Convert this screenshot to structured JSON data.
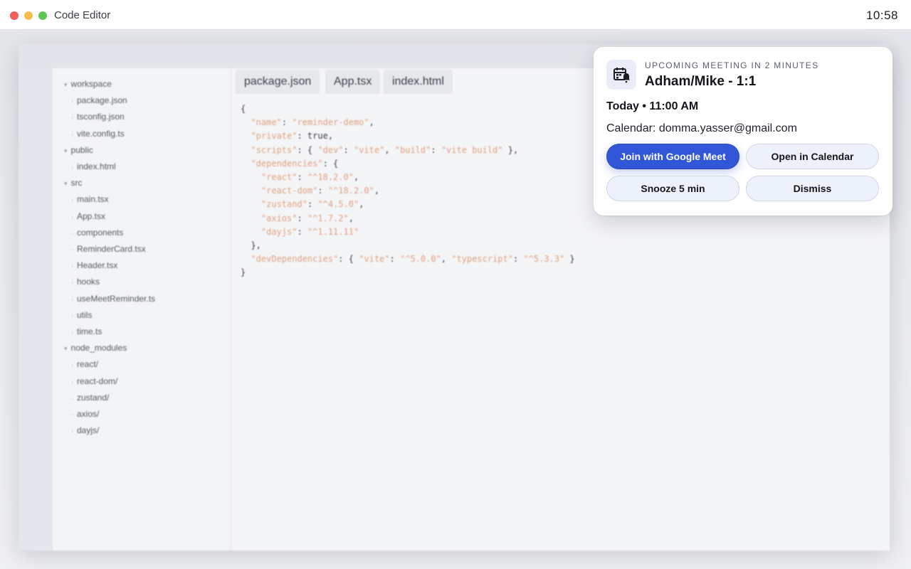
{
  "titlebar": {
    "app_title": "Code Editor",
    "clock": "10:58"
  },
  "explorer": {
    "items": [
      {
        "label": "workspace",
        "level": 0
      },
      {
        "label": "package.json",
        "level": 1
      },
      {
        "label": "tsconfig.json",
        "level": 1
      },
      {
        "label": "vite.config.ts",
        "level": 1
      },
      {
        "label": "public",
        "level": 0
      },
      {
        "label": "index.html",
        "level": 1
      },
      {
        "label": "src",
        "level": 0
      },
      {
        "label": "main.tsx",
        "level": 1
      },
      {
        "label": "App.tsx",
        "level": 1
      },
      {
        "label": "components",
        "level": 1
      },
      {
        "label": "ReminderCard.tsx",
        "level": 1
      },
      {
        "label": "Header.tsx",
        "level": 1
      },
      {
        "label": "hooks",
        "level": 1
      },
      {
        "label": "useMeetReminder.ts",
        "level": 1
      },
      {
        "label": "utils",
        "level": 1
      },
      {
        "label": "time.ts",
        "level": 1
      },
      {
        "label": "node_modules",
        "level": 0
      },
      {
        "label": "react/",
        "level": 1
      },
      {
        "label": "react-dom/",
        "level": 1
      },
      {
        "label": "zustand/",
        "level": 1
      },
      {
        "label": "axios/",
        "level": 1
      },
      {
        "label": "dayjs/",
        "level": 1
      }
    ]
  },
  "tabs": [
    "package.json",
    "App.tsx",
    "index.html"
  ],
  "code": [
    "{",
    "  \"name\": \"reminder-demo\",",
    "  \"private\": true,",
    "  \"scripts\": { \"dev\": \"vite\", \"build\": \"vite build\" },",
    "  \"dependencies\": {",
    "    \"react\": \"^18.2.0\",",
    "    \"react-dom\": \"^18.2.0\",",
    "    \"zustand\": \"^4.5.0\",",
    "    \"axios\": \"^1.7.2\",",
    "    \"dayjs\": \"^1.11.11\"",
    "  },",
    "  \"devDependencies\": { \"vite\": \"^5.0.0\", \"typescript\": \"^5.3.3\" }",
    "}"
  ],
  "notification": {
    "eyebrow": "UPCOMING MEETING IN 2 MINUTES",
    "title": "Adham/Mike - 1:1",
    "time": "Today • 11:00 AM",
    "calendar": "Calendar: domma.yasser@gmail.com",
    "icon": "calendar-bell-icon",
    "buttons": {
      "join": "Join with Google Meet",
      "open": "Open in Calendar",
      "snooze": "Snooze 5 min",
      "dismiss": "Dismiss"
    },
    "accent_color": "#3156d8"
  }
}
